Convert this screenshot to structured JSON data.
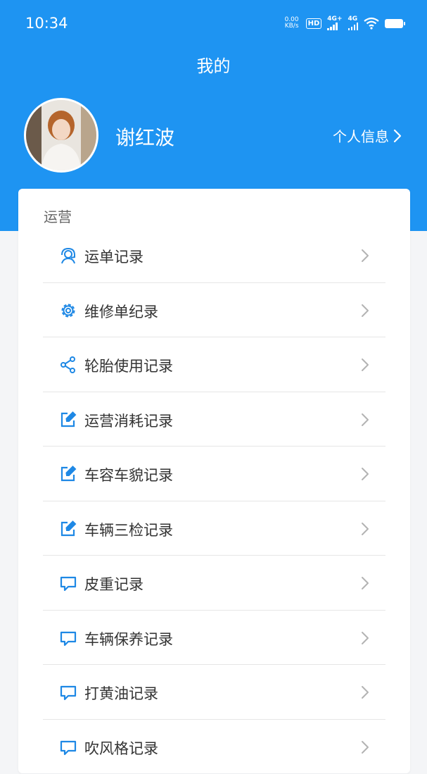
{
  "status_bar": {
    "time": "10:34",
    "speed_value": "0.00",
    "speed_unit": "KB/s",
    "hd_label": "HD",
    "sim1_label": "4G+",
    "sim2_label": "4G"
  },
  "header": {
    "title": "我的",
    "user_name": "谢红波",
    "profile_link": "个人信息"
  },
  "section": {
    "title": "运营",
    "items": [
      {
        "label": "运单记录",
        "icon": "headset-icon"
      },
      {
        "label": "维修单纪录",
        "icon": "gear-icon"
      },
      {
        "label": "轮胎使用记录",
        "icon": "share-icon"
      },
      {
        "label": "运营消耗记录",
        "icon": "edit-icon"
      },
      {
        "label": "车容车貌记录",
        "icon": "edit-icon"
      },
      {
        "label": "车辆三检记录",
        "icon": "edit-icon"
      },
      {
        "label": "皮重记录",
        "icon": "chat-icon"
      },
      {
        "label": "车辆保养记录",
        "icon": "chat-icon"
      },
      {
        "label": "打黄油记录",
        "icon": "chat-icon"
      },
      {
        "label": "吹风格记录",
        "icon": "chat-icon"
      }
    ]
  },
  "colors": {
    "header": "#1e94f2",
    "icon": "#1e88e5",
    "background": "#f4f5f7"
  }
}
